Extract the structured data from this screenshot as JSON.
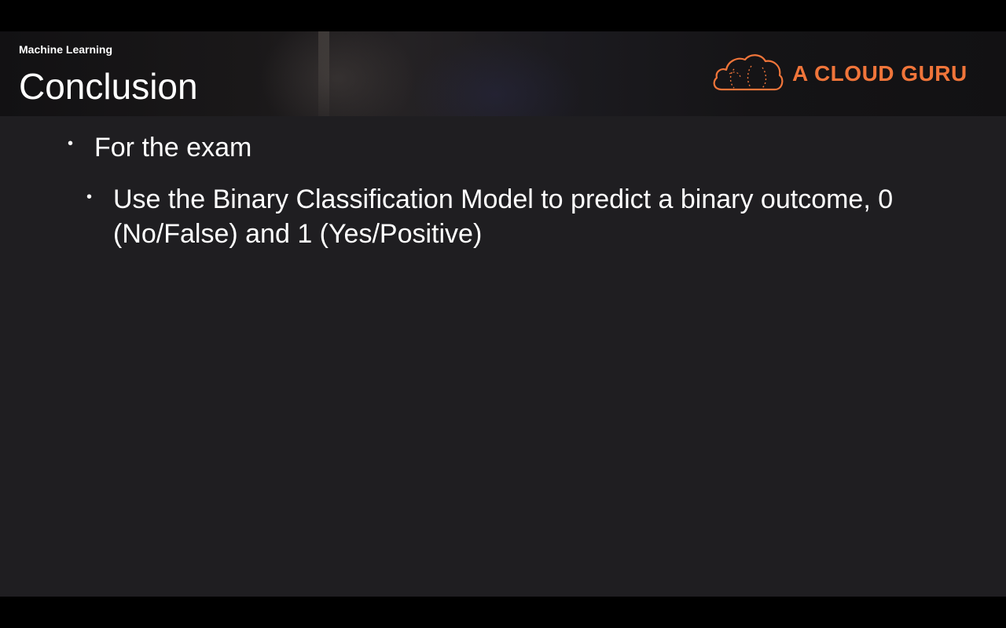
{
  "header": {
    "course_label": "Machine Learning",
    "title": "Conclusion"
  },
  "brand": {
    "logo_icon": "cloud-logo-icon",
    "name": "A CLOUD GURU",
    "color": "#f0753a"
  },
  "bullets": [
    {
      "level": 1,
      "marker": "•",
      "text": "For the exam"
    },
    {
      "level": 2,
      "marker": "•",
      "text": "Use the Binary Classification Model to predict a binary outcome, 0 (No/False) and 1 (Yes/Positive)"
    }
  ],
  "colors": {
    "slide_background": "#1f1e21",
    "text": "#ffffff",
    "accent": "#f0753a"
  }
}
